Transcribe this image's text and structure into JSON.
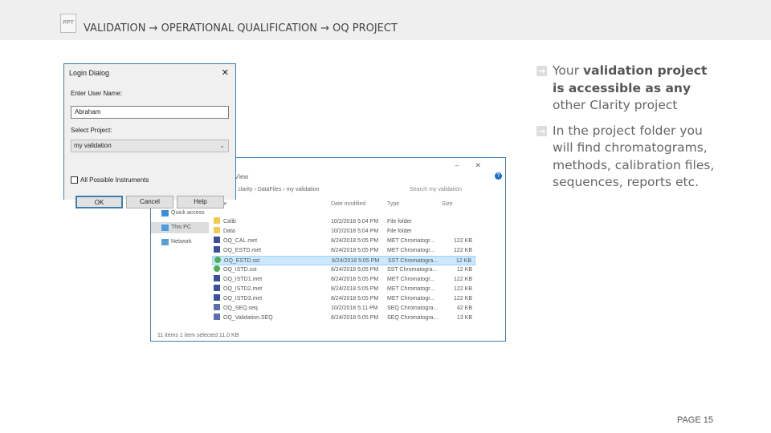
{
  "header": {
    "breadcrumb": "VALIDATION → OPERATIONAL QUALIFICATION → OQ PROJECT",
    "icon": "ppt-file-icon"
  },
  "bullets": [
    {
      "pre": "Your ",
      "bold": "validation project is accessible as any",
      "post": " other Clarity project"
    },
    {
      "pre": "In the project folder you will find chromatograms, methods, calibration files, sequences, reports etc.",
      "bold": "",
      "post": ""
    }
  ],
  "page": "PAGE 15",
  "dialog": {
    "title": "Login Dialog",
    "close": "✕",
    "user_label": "Enter User Name:",
    "user_value": "Abraham",
    "project_label": "Select Project:",
    "project_value": "my validation",
    "checkbox_label": "All Possible Instruments",
    "checked": false,
    "ok": "OK",
    "cancel": "Cancel",
    "help": "Help"
  },
  "explorer": {
    "menu_view": "View",
    "address": "› clarity › DataFiles › my validation",
    "search_placeholder": "Search my validation",
    "nav": [
      "Quick access",
      "This PC",
      "Network"
    ],
    "columns": [
      "Name",
      "Date modified",
      "Type",
      "Size"
    ],
    "rows": [
      {
        "name": "Calib",
        "date": "10/2/2018 5:04 PM",
        "type": "File folder",
        "size": "",
        "icon": "folder",
        "sel": false
      },
      {
        "name": "Data",
        "date": "10/2/2018 5:04 PM",
        "type": "File folder",
        "size": "",
        "icon": "folder",
        "sel": false
      },
      {
        "name": "OQ_CAL.met",
        "date": "8/24/2018 5:05 PM",
        "type": "MET Chromatogr...",
        "size": "122 KB",
        "icon": "met",
        "sel": false
      },
      {
        "name": "OQ_ESTD.met",
        "date": "8/24/2018 5:05 PM",
        "type": "MET Chromatogr...",
        "size": "122 KB",
        "icon": "met",
        "sel": false
      },
      {
        "name": "OQ_ESTD.sst",
        "date": "8/24/2018 5:05 PM",
        "type": "SST Chromatogra...",
        "size": "12 KB",
        "icon": "sst",
        "sel": true
      },
      {
        "name": "OQ_ISTD.sst",
        "date": "8/24/2018 5:05 PM",
        "type": "SST Chromatogra...",
        "size": "12 KB",
        "icon": "sst",
        "sel": false
      },
      {
        "name": "OQ_ISTD1.met",
        "date": "8/24/2018 5:05 PM",
        "type": "MET Chromatogr...",
        "size": "122 KB",
        "icon": "met",
        "sel": false
      },
      {
        "name": "OQ_ISTD2.met",
        "date": "8/24/2018 5:05 PM",
        "type": "MET Chromatogr...",
        "size": "122 KB",
        "icon": "met",
        "sel": false
      },
      {
        "name": "OQ_ISTD3.met",
        "date": "8/24/2018 5:05 PM",
        "type": "MET Chromatogr...",
        "size": "122 KB",
        "icon": "met",
        "sel": false
      },
      {
        "name": "OQ_SEQ.seq",
        "date": "10/2/2018 5:11 PM",
        "type": "SEQ Chromatogra...",
        "size": "42 KB",
        "icon": "seq",
        "sel": false
      },
      {
        "name": "OQ_Validation.SEQ",
        "date": "8/24/2018 5:05 PM",
        "type": "SEQ Chromatogra...",
        "size": "13 KB",
        "icon": "seq",
        "sel": false
      }
    ],
    "status": "11 items    1 item selected  11.0 KB",
    "icon_colors": {
      "folder": "#f3c94f",
      "met": "#3a4fa0",
      "sst": "#4caf50",
      "seq": "#5a6fb0"
    }
  }
}
